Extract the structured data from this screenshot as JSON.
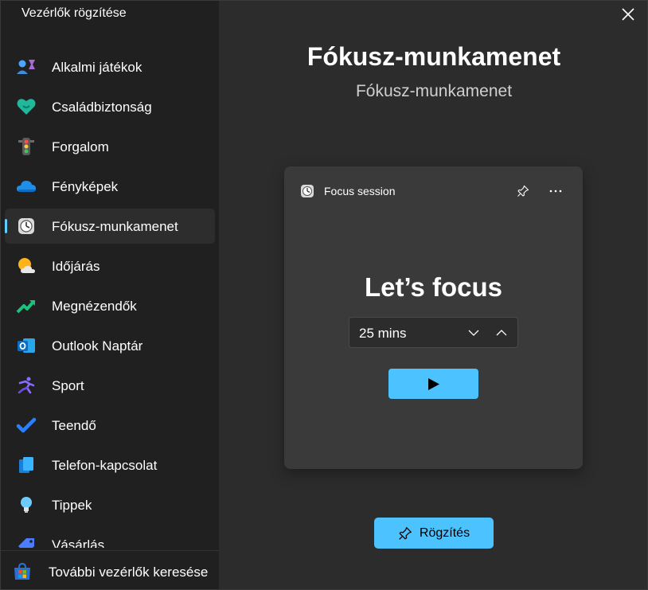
{
  "sidebar": {
    "title": "Vezérlők rögzítése",
    "items": [
      {
        "label": "Alkalmi játékok",
        "icon": "casual-games-icon"
      },
      {
        "label": "Családbiztonság",
        "icon": "family-safety-icon"
      },
      {
        "label": "Forgalom",
        "icon": "traffic-light-icon"
      },
      {
        "label": "Fényképek",
        "icon": "onedrive-cloud-icon"
      },
      {
        "label": "Fókusz-munkamenet",
        "icon": "focus-clock-icon",
        "selected": true
      },
      {
        "label": "Időjárás",
        "icon": "weather-sun-cloud-icon"
      },
      {
        "label": "Megnézendők",
        "icon": "watchlist-trend-icon"
      },
      {
        "label": "Outlook Naptár",
        "icon": "outlook-icon"
      },
      {
        "label": "Sport",
        "icon": "sport-runner-icon"
      },
      {
        "label": "Teendő",
        "icon": "todo-check-icon"
      },
      {
        "label": "Telefon-kapcsolat",
        "icon": "phone-link-icon"
      },
      {
        "label": "Tippek",
        "icon": "tips-bulb-icon"
      },
      {
        "label": "Vásárlás",
        "icon": "shopping-tag-icon"
      }
    ],
    "find_more_label": "További vezérlők keresése",
    "find_more_icon": "store-icon"
  },
  "main": {
    "title": "Fókusz-munkamenet",
    "subtitle": "Fókusz-munkamenet"
  },
  "widget": {
    "name": "Focus session",
    "heading": "Let’s focus",
    "duration": "25 mins"
  },
  "pin_button": {
    "label": "Rögzítés"
  },
  "colors": {
    "accent": "#4cc2ff",
    "sidebar_bg": "#202020",
    "main_bg": "#2c2c2c",
    "card_bg": "#3a3a3a"
  }
}
